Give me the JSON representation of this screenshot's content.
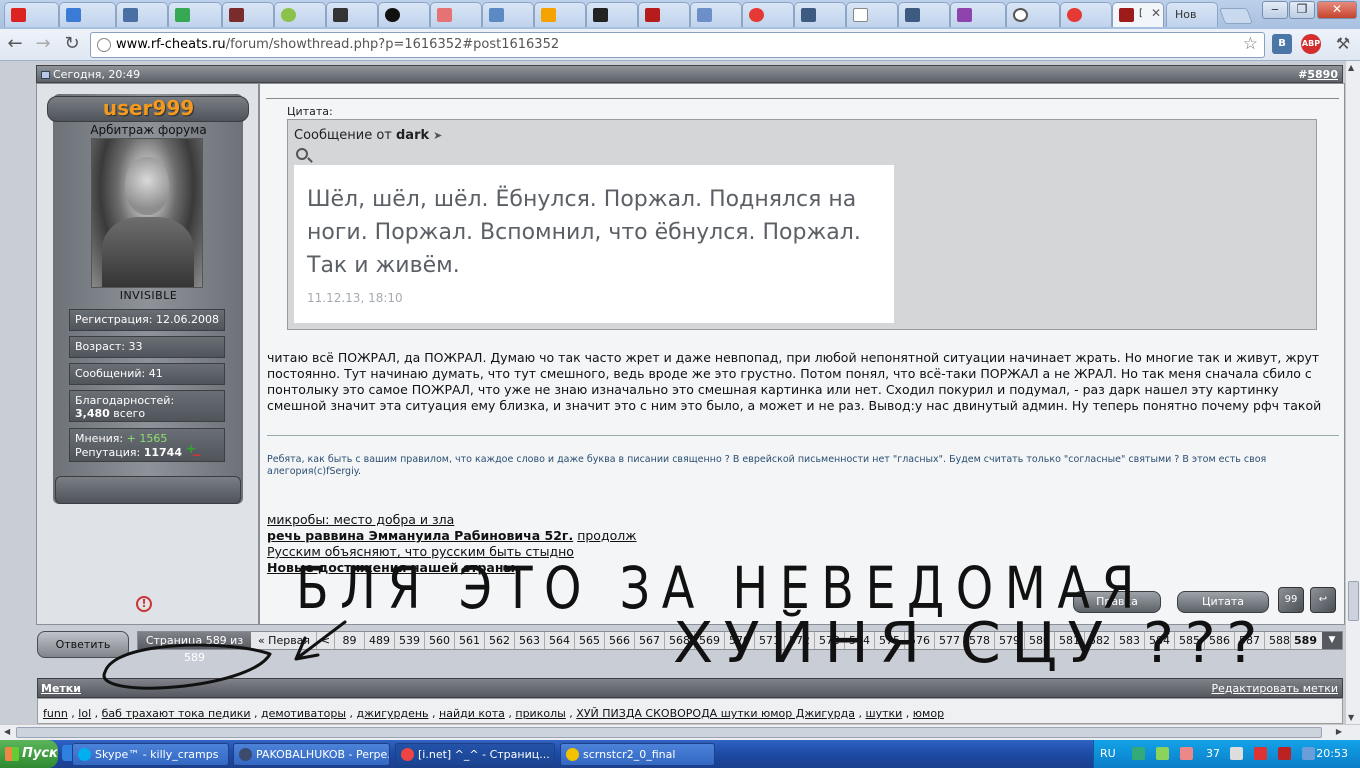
{
  "browser": {
    "active_tab_title": "[",
    "last_tab_title": "Нов",
    "url_host": "www.rf-cheats.ru",
    "url_path": "/forum/showthread.php?p=1616352#post1616352",
    "extensions": [
      "В",
      "ABP"
    ]
  },
  "post": {
    "date": "Сегодня, 20:49",
    "number_prefix": "#",
    "number": "5890"
  },
  "user": {
    "name": "user999",
    "title": "Арбитраж форума",
    "status": "INVISIBLE",
    "registration": "Регистрация: 12.06.2008",
    "age": "Возраст: 33",
    "messages": "Сообщений: 41",
    "thanks_label": "Благодарностей:",
    "thanks_value": "3,480",
    "thanks_suffix": "всего",
    "opinions_label": "Мнения:",
    "opinions_value": "+ 1565",
    "reputation_label": "Репутация:",
    "reputation_value": "11744"
  },
  "quote": {
    "label": "Цитата:",
    "from_prefix": "Сообщение от",
    "from_user": "dark",
    "image_text": "Шёл, шёл, шёл. Ёбнулся. Поржал. Поднялся на ноги. Поржал. Вспомнил, что ёбнулся. Поржал. Так и живём.",
    "image_date": "11.12.13, 18:10"
  },
  "body_text": "читаю всё ПОЖРАЛ, да ПОЖРАЛ. Думаю чо так часто жрет и даже невпопад, при любой непонятной ситуации начинает жрать. Но многие так и живут, жрут постоянно. Тут начинаю думать, что тут смешного, ведь вроде же это грустно. Потом понял, что всё-таки ПОРЖАЛ а не ЖРАЛ. Но так меня сначала сбило с понтолыку это самое ПОЖРАЛ, что уже не знаю изначально это смешная картинка или нет. Сходил покурил и подумал, - раз дарк нашел эту картинку смешной значит эта ситуация ему близка, и значит это с ним это было, а может и не раз. Вывод:у нас двинутый админ. Ну теперь понятно почему рфч такой",
  "signature": "Ребята, как быть с вашим правилом, что каждое слово и даже буква в писании священно ? В еврейской письменности нет \"гласных\". Будем считать только \"согласные\" святыми ? В этом есть своя алегория(c)fSergiy.",
  "sig_links": {
    "l1": "микробы: место добра и зла",
    "l2_bold": "речь раввина Эммануила Рабиновича 52г.",
    "l2_more": "продолж",
    "l3": "Русским объясняют, что русским быть стыдно",
    "l4": "Новые достижения нашей страны"
  },
  "buttons": {
    "edit": "Правка",
    "quote": "Цитата",
    "reply": "Ответить"
  },
  "pager": {
    "info": "Страница 589 из 589",
    "first": "« Первая",
    "lt": "<",
    "pages": [
      "89",
      "489",
      "539",
      "560",
      "561",
      "562",
      "563",
      "564",
      "565",
      "566",
      "567",
      "568",
      "569",
      "570",
      "571",
      "572",
      "573",
      "574",
      "575",
      "576",
      "577",
      "578",
      "579",
      "580",
      "581",
      "582",
      "583",
      "584",
      "585",
      "586",
      "587",
      "588"
    ],
    "current": "589"
  },
  "tags": {
    "title": "Метки",
    "edit": "Редактировать метки",
    "items": [
      "funn",
      "lol",
      "баб трахают тока педики",
      "демотиваторы",
      "джигурдень",
      "найди кота",
      "приколы",
      "ХУЙ ПИЗДА СКОВОРОДА шутки юмор Джигурда",
      "шутки",
      "юмор"
    ]
  },
  "handwriting": {
    "line1": "БЛЯ ЭТО ЗА НЕВЕДОМАЯ",
    "line2": "ХУЙНЯ СЦУ ???"
  },
  "taskbar": {
    "start": "Пуск",
    "tasks": [
      "Skype™ - killy_cramps",
      "PAKOBALHUKOB - Perpe...",
      "[i.net] ^_^ - Страниц...",
      "scrnstcr2_0_final"
    ],
    "lang": "RU",
    "temp": "37",
    "time": "20:53"
  },
  "colors": {
    "username": "#f29a20",
    "opinions": "#8be26d",
    "taskbar": "#1d4aa4",
    "tray": "#0b7dc9"
  }
}
